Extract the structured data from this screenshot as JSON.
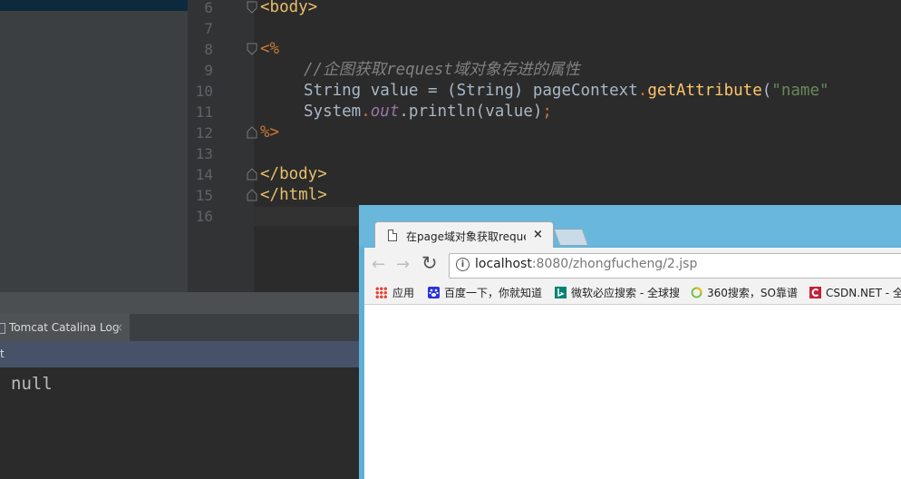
{
  "editor": {
    "lines": [
      {
        "num": "6"
      },
      {
        "num": "7"
      },
      {
        "num": "8"
      },
      {
        "num": "9"
      },
      {
        "num": "10"
      },
      {
        "num": "11"
      },
      {
        "num": "12"
      },
      {
        "num": "13"
      },
      {
        "num": "14"
      },
      {
        "num": "15"
      },
      {
        "num": "16"
      }
    ],
    "code": {
      "l6": "<body>",
      "l8": "<%",
      "l9": "//企图获取request域对象存进的属性",
      "l10_a": "String value = (String) pageContext",
      "l10_b": ".",
      "l10_c": "getAttribute",
      "l10_d": "(",
      "l10_e": "\"name\"",
      "l11_a": "System",
      "l11_b": ".",
      "l11_c": "out",
      "l11_d": ".println(value)",
      "l11_e": ";",
      "l12": "%>",
      "l14": "</body>",
      "l15": "</html>"
    }
  },
  "bottom_panel": {
    "tab_label": "Tomcat Catalina Log",
    "tab_close": "×",
    "subbar_text": "t",
    "console_output": "null"
  },
  "browser": {
    "tab_title": "在page域对象获取reque",
    "tab_close": "×",
    "url_host": "localhost",
    "url_rest": ":8080/zhongfucheng/2.jsp",
    "back_glyph": "←",
    "forward_glyph": "→",
    "reload_glyph": "↻",
    "info_glyph": "i",
    "bookmarks": [
      {
        "label": "应用"
      },
      {
        "label": "百度一下，你就知道"
      },
      {
        "label": "微软必应搜索 - 全球搜"
      },
      {
        "label": "360搜索，SO靠谱"
      },
      {
        "label": "CSDN.NET - 全"
      }
    ]
  },
  "colors": {
    "ide_bg": "#2b2b2b",
    "browser_frame": "#5fb0d6",
    "csdn_red": "#c32136",
    "bing_teal": "#008373",
    "baidu_blue": "#2932e1"
  }
}
